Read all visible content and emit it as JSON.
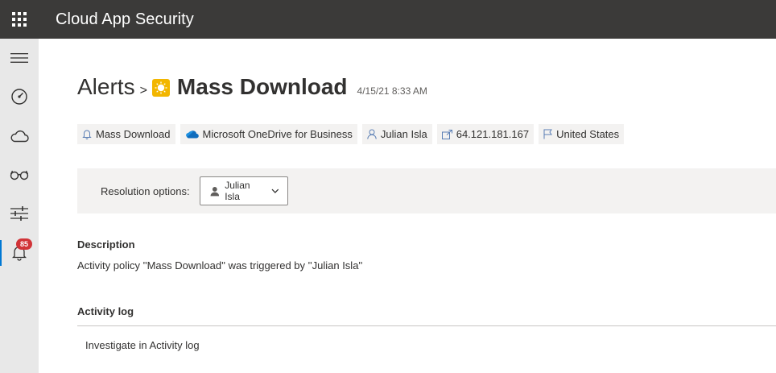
{
  "topbar": {
    "app_title": "Cloud App Security",
    "waffle_icon": "app-launcher-icon",
    "color": "#3b3a39"
  },
  "rail": {
    "items": [
      {
        "icon": "hamburger-menu-icon"
      },
      {
        "icon": "dashboard-gauge-icon"
      },
      {
        "icon": "cloud-icon"
      },
      {
        "icon": "investigate-glasses-icon"
      },
      {
        "icon": "control-sliders-icon"
      },
      {
        "icon": "alerts-bell-icon",
        "badge": "85",
        "active": true
      }
    ]
  },
  "header": {
    "breadcrumb": "Alerts",
    "separator": ">",
    "severity_icon": "medium-severity-sun-icon",
    "severity_color": "#f2b600",
    "title": "Mass Download",
    "timestamp": "4/15/21 8:33 AM"
  },
  "pills": [
    {
      "icon": "policy-bell-icon",
      "label": "Mass Download"
    },
    {
      "icon": "onedrive-cloud-icon",
      "label": "Microsoft OneDrive for Business"
    },
    {
      "icon": "user-icon",
      "label": "Julian Isla"
    },
    {
      "icon": "ip-address-icon",
      "label": "64.121.181.167"
    },
    {
      "icon": "flag-icon",
      "label": "United States"
    }
  ],
  "resolution": {
    "label": "Resolution options:",
    "dropdown_value": "Julian Isla"
  },
  "description": {
    "heading": "Description",
    "text": "Activity policy ''Mass Download'' was triggered by ''Julian Isla''"
  },
  "activity_log": {
    "heading": "Activity log",
    "link": "Investigate in Activity log"
  }
}
